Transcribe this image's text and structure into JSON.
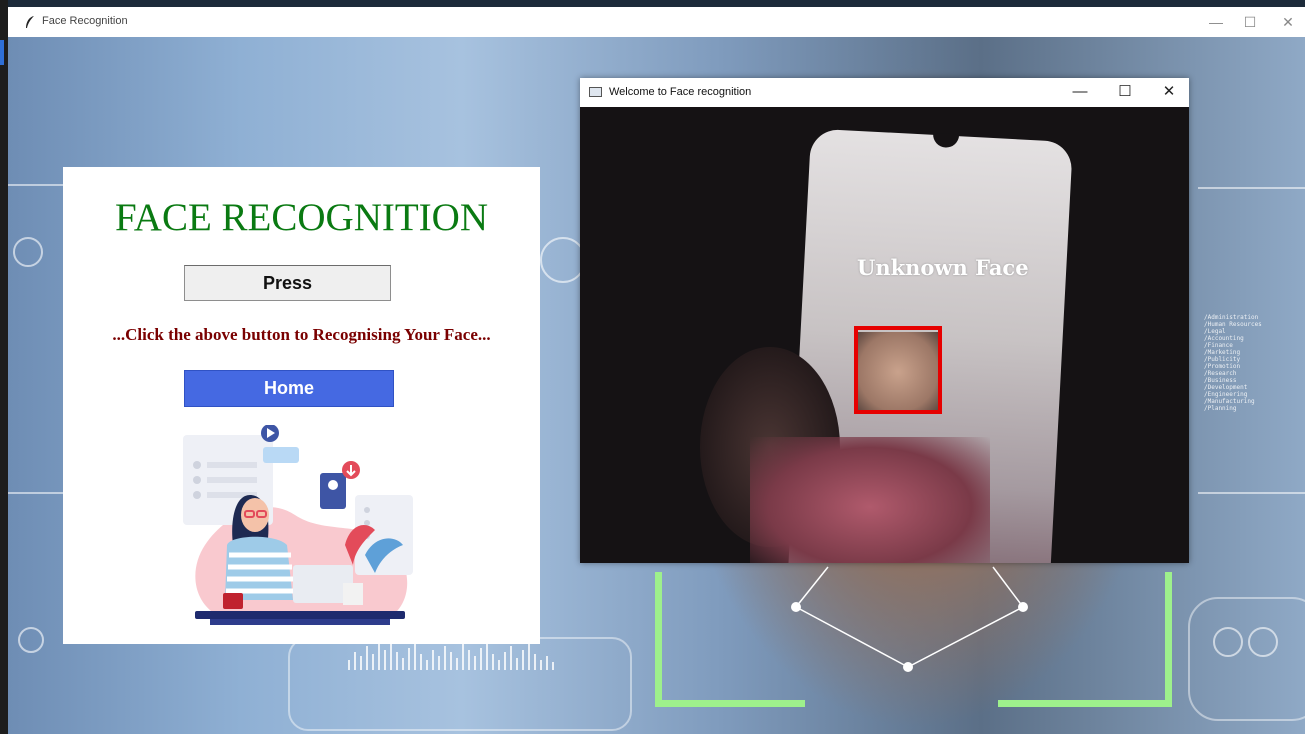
{
  "main_window": {
    "title": "Face Recognition",
    "controls": {
      "minimize": "—",
      "maximize": "☐",
      "close": "✕"
    }
  },
  "panel": {
    "heading": "FACE RECOGNITION",
    "press_label": "Press",
    "hint": "...Click the above button to Recognising Your Face...",
    "home_label": "Home"
  },
  "camera_window": {
    "title": "Welcome to Face recognition",
    "controls": {
      "minimize": "—",
      "maximize": "☐",
      "close": "✕"
    },
    "detection_label": "Unknown Face",
    "box_color": "#e60000"
  },
  "background": {
    "side_text": [
      "/Administration",
      "/Human Resources",
      "/Legal",
      "/Accounting",
      "/Finance",
      "/Marketing",
      "/Publicity",
      "/Promotion",
      "/Research",
      "/Business",
      "/Development",
      "/Engineering",
      "/Manufacturing",
      "/Planning"
    ]
  },
  "colors": {
    "heading_green": "#0a7a12",
    "hint_red": "#7a0000",
    "home_blue": "#4569e2"
  }
}
